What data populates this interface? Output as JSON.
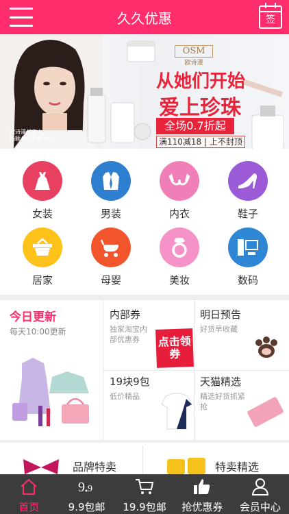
{
  "header": {
    "title": "久久优惠",
    "sign_label": "签"
  },
  "banner": {
    "brand": "OSM",
    "brand_sub": "欧诗漫",
    "headline1": "从她们开始",
    "headline2": "爱上珍珠",
    "promo": "全场0.7折起",
    "offer": "满110减18 | 上不封顶",
    "signature": "欧诗漫代言人\n杨颖Angelababy"
  },
  "categories": [
    {
      "label": "女装",
      "icon": "dress-icon",
      "color": "#e84060"
    },
    {
      "label": "男装",
      "icon": "suit-icon",
      "color": "#2f7fd1"
    },
    {
      "label": "内衣",
      "icon": "bra-icon",
      "color": "#f07fb7"
    },
    {
      "label": "鞋子",
      "icon": "heel-icon",
      "color": "#9b5bd6"
    },
    {
      "label": "居家",
      "icon": "basket-icon",
      "color": "#ffc21a"
    },
    {
      "label": "母婴",
      "icon": "stroller-icon",
      "color": "#f2552c"
    },
    {
      "label": "美妆",
      "icon": "ring-icon",
      "color": "#f592c8"
    },
    {
      "label": "数码",
      "icon": "computer-icon",
      "color": "#2f86d4"
    }
  ],
  "today": {
    "title": "今日更新",
    "subtitle": "每天10:00更新"
  },
  "cells": {
    "inner_coupon": {
      "title": "内部券",
      "desc": "独家淘宝内部优惠券",
      "tag": "点击领券"
    },
    "preview": {
      "title": "明日预告",
      "desc": "好货早收藏"
    },
    "nine": {
      "title": "19块9包",
      "desc": "低价精品"
    },
    "tmall": {
      "title": "天猫精选",
      "desc": "精选好货抓紧抢"
    }
  },
  "brand_row": {
    "left": "品牌特卖",
    "right": "特卖精选"
  },
  "tabs": [
    {
      "label": "首页",
      "icon": "home-icon",
      "active": true
    },
    {
      "label": "9.9包邮",
      "icon": "nine-nine-icon",
      "active": false
    },
    {
      "label": "19.9包邮",
      "icon": "cart-icon",
      "active": false
    },
    {
      "label": "抢优惠券",
      "icon": "thumbs-up-icon",
      "active": false
    },
    {
      "label": "会员中心",
      "icon": "user-icon",
      "active": false
    }
  ],
  "colors": {
    "accent": "#ff2d6b",
    "tabbar": "#3c3c3c"
  }
}
